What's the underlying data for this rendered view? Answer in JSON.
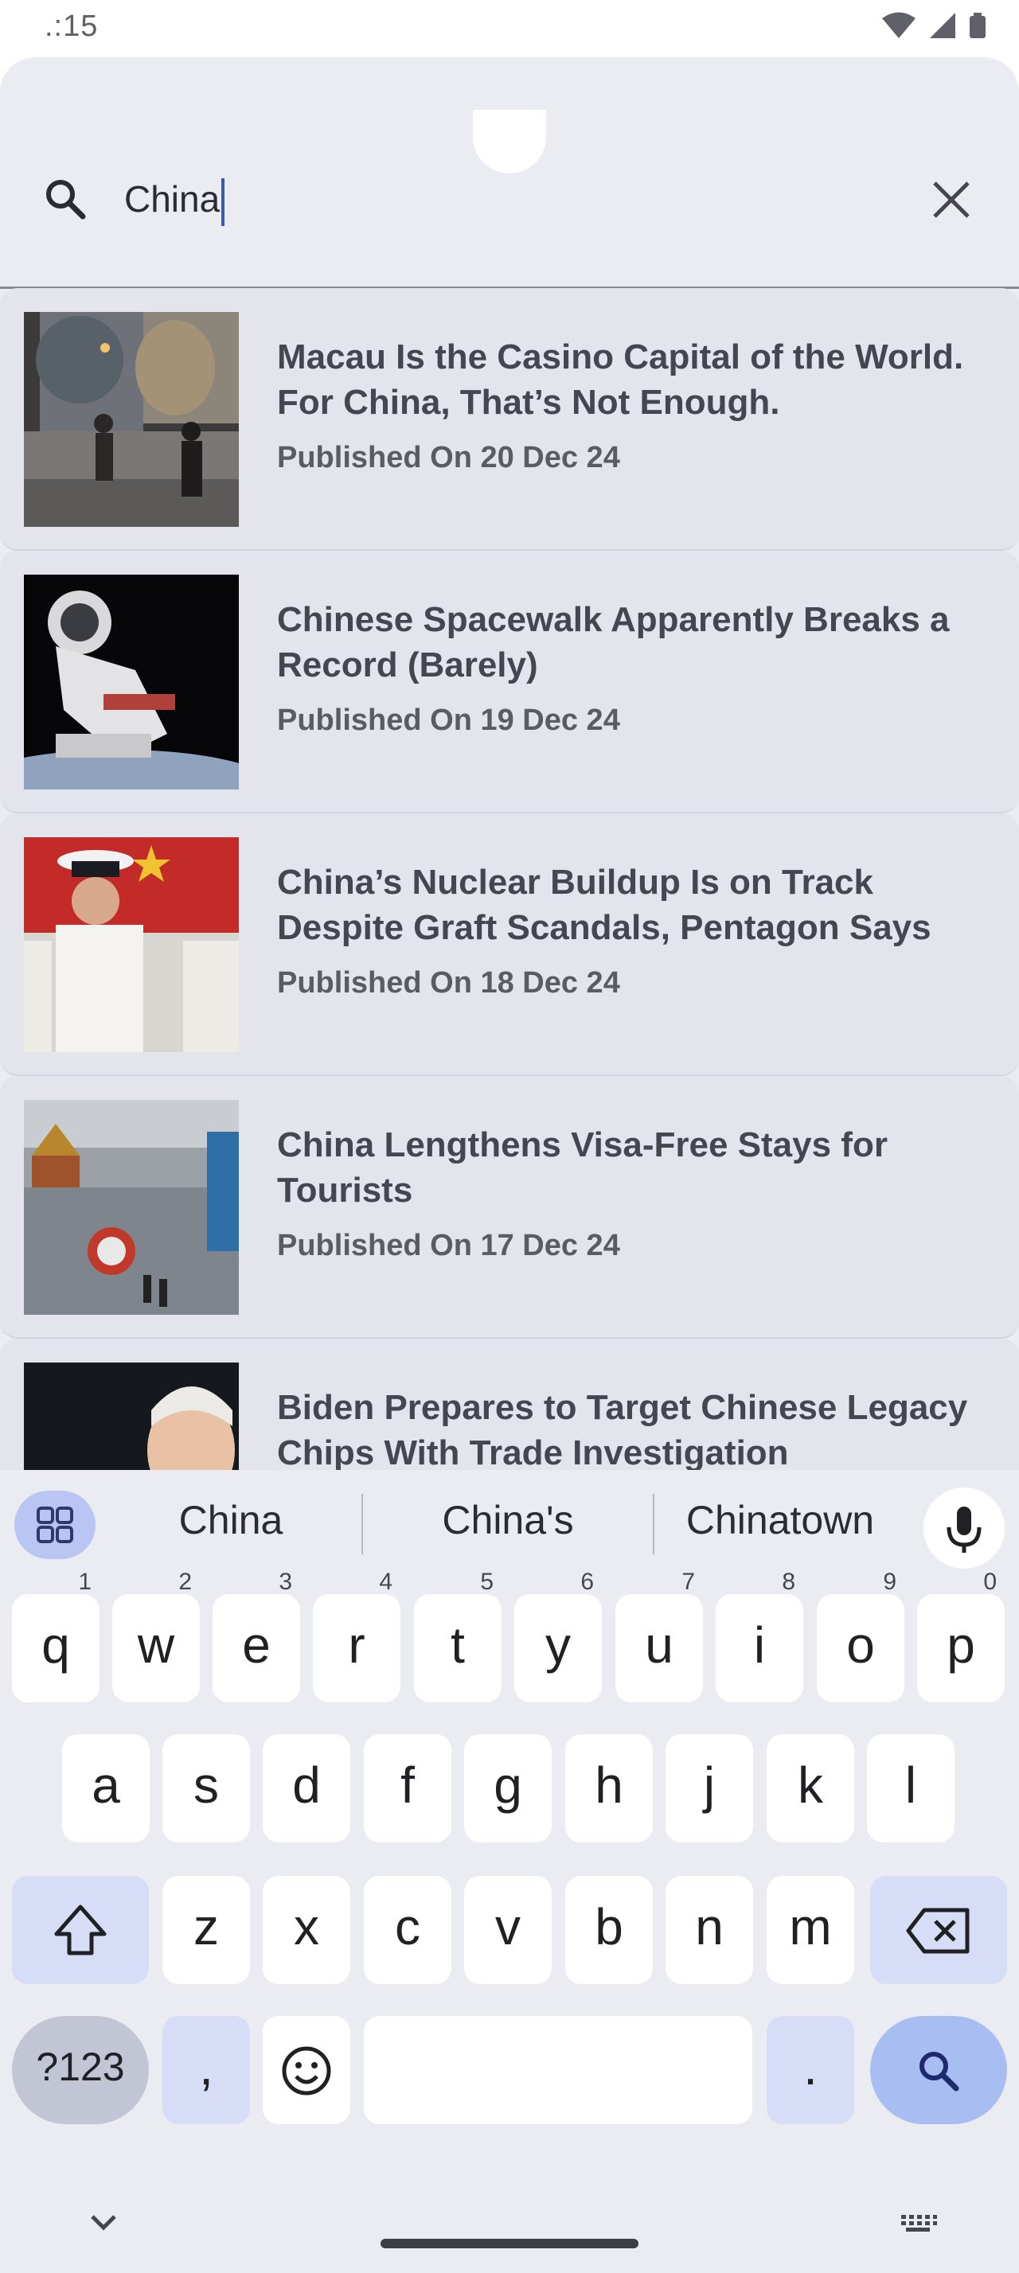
{
  "status_bar": {
    "time": ".:15"
  },
  "search": {
    "query": "China"
  },
  "results": [
    {
      "title": "Macau Is the Casino Capital of the World. For China, That’s Not Enough.",
      "date": "Published On 20 Dec 24",
      "thumb_color": "#5a5048"
    },
    {
      "title": "Chinese Spacewalk Apparently Breaks a Record (Barely)",
      "date": "Published On 19 Dec 24",
      "thumb_color": "#0a0a0c"
    },
    {
      "title": "China’s Nuclear Buildup Is on Track Despite Graft Scandals, Pentagon Says",
      "date": "Published On 18 Dec 24",
      "thumb_color": "#c02a2a"
    },
    {
      "title": "China Lengthens Visa-Free Stays for Tourists",
      "date": "Published On 17 Dec 24",
      "thumb_color": "#8a8f96"
    },
    {
      "title": "Biden Prepares to Target Chinese Legacy Chips With Trade Investigation",
      "date": "",
      "thumb_color": "#1a1d22"
    }
  ],
  "keyboard": {
    "suggestions": [
      "China",
      "China's",
      "Chinatown"
    ],
    "row1": [
      {
        "key": "q",
        "hint": "1"
      },
      {
        "key": "w",
        "hint": "2"
      },
      {
        "key": "e",
        "hint": "3"
      },
      {
        "key": "r",
        "hint": "4"
      },
      {
        "key": "t",
        "hint": "5"
      },
      {
        "key": "y",
        "hint": "6"
      },
      {
        "key": "u",
        "hint": "7"
      },
      {
        "key": "i",
        "hint": "8"
      },
      {
        "key": "o",
        "hint": "9"
      },
      {
        "key": "p",
        "hint": "0"
      }
    ],
    "row2": [
      "a",
      "s",
      "d",
      "f",
      "g",
      "h",
      "j",
      "k",
      "l"
    ],
    "row3": [
      "z",
      "x",
      "c",
      "v",
      "b",
      "n",
      "m"
    ],
    "symbols_label": "?123",
    "comma": ",",
    "period": "."
  },
  "colors": {
    "surface": "#ebebf2",
    "card": "#e4e4ec",
    "accent": "#a8bdf2",
    "caret": "#3d5aa8"
  }
}
